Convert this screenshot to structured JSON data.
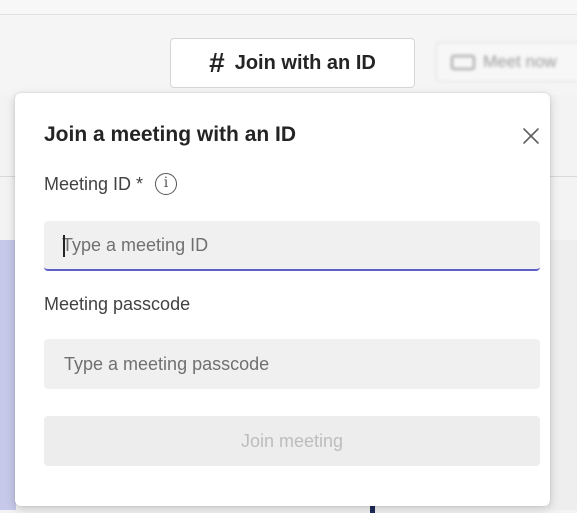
{
  "toolbar": {
    "join_with_id_label": "Join with an ID",
    "join_with_id_icon": "hash-icon",
    "meet_now_label": "Meet now",
    "meet_now_icon": "video-icon"
  },
  "dialog": {
    "title": "Join a meeting with an ID",
    "close_icon": "close-icon",
    "meeting_id": {
      "label": "Meeting ID *",
      "info_icon": "info-icon",
      "info_glyph": "i",
      "value": "",
      "placeholder": "Type a meeting ID",
      "focused": true
    },
    "passcode": {
      "label": "Meeting passcode",
      "value": "",
      "placeholder": "Type a meeting passcode"
    },
    "join_button_label": "Join meeting",
    "join_button_enabled": false
  },
  "colors": {
    "accent": "#5b5fc7",
    "disabled_text": "#bdbdbd",
    "field_background": "#f0f0f0"
  }
}
